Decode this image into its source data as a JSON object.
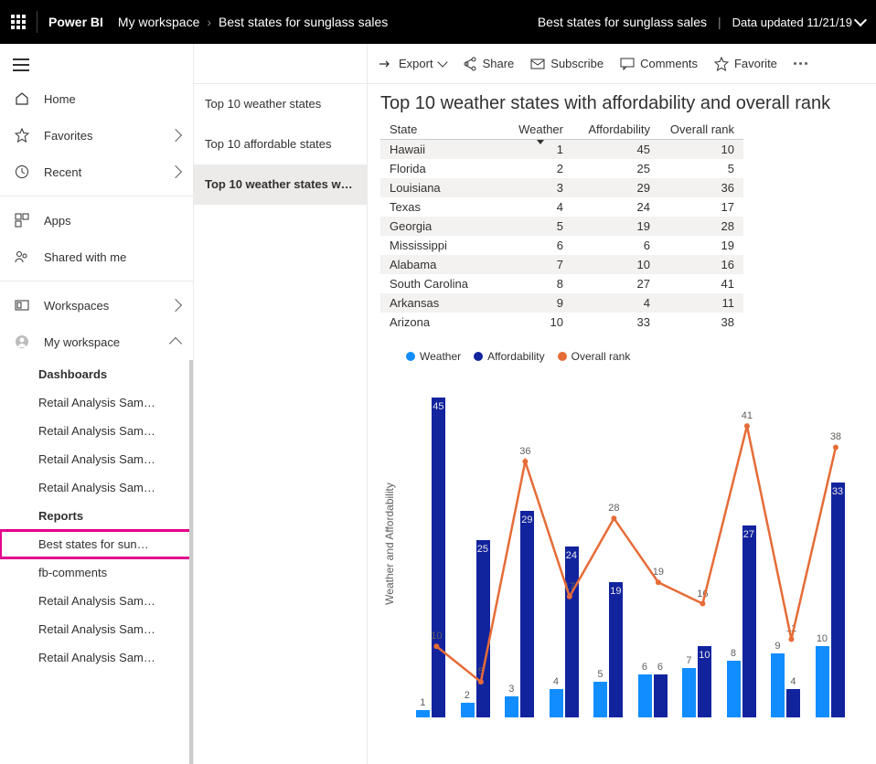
{
  "topbar": {
    "brand": "Power BI",
    "crumb1": "My workspace",
    "crumb2": "Best states for sunglass sales",
    "right_title": "Best states for sunglass sales",
    "updated": "Data updated 11/21/19"
  },
  "nav": {
    "home": "Home",
    "favorites": "Favorites",
    "recent": "Recent",
    "apps": "Apps",
    "shared": "Shared with me",
    "workspaces": "Workspaces",
    "myworkspace": "My workspace",
    "section1": "Dashboards",
    "dashboards": [
      "Retail Analysis Sam…",
      "Retail Analysis Sam…",
      "Retail Analysis Sam…",
      "Retail Analysis Sam…"
    ],
    "section2": "Reports",
    "reports": [
      "Best states for sun…",
      "fb-comments",
      "Retail Analysis Sam…",
      "Retail Analysis Sam…",
      "Retail Analysis Sam…"
    ]
  },
  "pages": {
    "items": [
      "Top 10 weather states",
      "Top 10 affordable states",
      "Top 10 weather states w…"
    ],
    "active_index": 2
  },
  "toolbar": {
    "export": "Export",
    "share": "Share",
    "subscribe": "Subscribe",
    "comments": "Comments",
    "favorite": "Favorite"
  },
  "report": {
    "title": "Top 10 weather states with affordability and overall rank",
    "columns": [
      "State",
      "Weather",
      "Affordability",
      "Overall rank"
    ],
    "sort_col": 1,
    "rows": [
      {
        "state": "Hawaii",
        "weather": 1,
        "afford": 45,
        "overall": 10
      },
      {
        "state": "Florida",
        "weather": 2,
        "afford": 25,
        "overall": 5
      },
      {
        "state": "Louisiana",
        "weather": 3,
        "afford": 29,
        "overall": 36
      },
      {
        "state": "Texas",
        "weather": 4,
        "afford": 24,
        "overall": 17
      },
      {
        "state": "Georgia",
        "weather": 5,
        "afford": 19,
        "overall": 28
      },
      {
        "state": "Mississippi",
        "weather": 6,
        "afford": 6,
        "overall": 19
      },
      {
        "state": "Alabama",
        "weather": 7,
        "afford": 10,
        "overall": 16
      },
      {
        "state": "South Carolina",
        "weather": 8,
        "afford": 27,
        "overall": 41
      },
      {
        "state": "Arkansas",
        "weather": 9,
        "afford": 4,
        "overall": 11
      },
      {
        "state": "Arizona",
        "weather": 10,
        "afford": 33,
        "overall": 38
      }
    ]
  },
  "chart_data": {
    "type": "bar",
    "title": "",
    "ylabel": "Weather and Affordability",
    "categories": [
      "Hawaii",
      "Florida",
      "Louisiana",
      "Texas",
      "Georgia",
      "Mississippi",
      "Alabama",
      "South Carolina",
      "Arkansas",
      "Arizona"
    ],
    "series": [
      {
        "name": "Weather",
        "values": [
          1,
          2,
          3,
          4,
          5,
          6,
          7,
          8,
          9,
          10
        ],
        "color": "#118dff",
        "kind": "bar"
      },
      {
        "name": "Affordability",
        "values": [
          45,
          25,
          29,
          24,
          19,
          6,
          10,
          27,
          4,
          33
        ],
        "color": "#12239e",
        "kind": "bar"
      },
      {
        "name": "Overall rank",
        "values": [
          10,
          5,
          36,
          17,
          28,
          19,
          16,
          41,
          11,
          38
        ],
        "color": "#e66c37",
        "kind": "line"
      }
    ],
    "ylim": [
      0,
      45
    ]
  },
  "legend": {
    "weather": "Weather",
    "afford": "Affordability",
    "overall": "Overall rank"
  }
}
